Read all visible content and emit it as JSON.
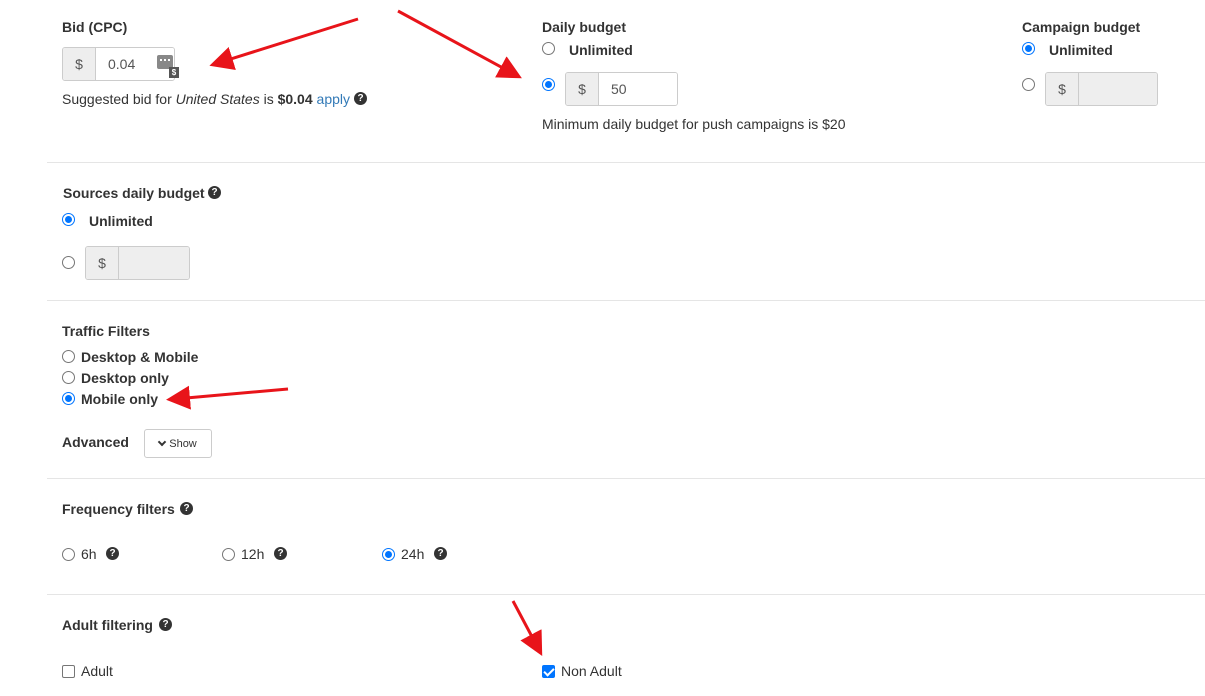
{
  "bid": {
    "title": "Bid (CPC)",
    "currency": "$",
    "value": "0.04",
    "suggest_prefix": "Suggested bid for ",
    "suggest_country": "United States",
    "suggest_mid": " is ",
    "suggest_amount": "$0.04",
    "apply_label": "apply"
  },
  "daily_budget": {
    "title": "Daily budget",
    "unlimited_label": "Unlimited",
    "currency": "$",
    "value": "50",
    "hint": "Minimum daily budget for push campaigns is $20"
  },
  "campaign_budget": {
    "title": "Campaign budget",
    "unlimited_label": "Unlimited",
    "currency": "$",
    "value": ""
  },
  "sources_budget": {
    "title": "Sources daily budget",
    "unlimited_label": "Unlimited",
    "currency": "$",
    "value": ""
  },
  "traffic_filters": {
    "title": "Traffic Filters",
    "options": [
      "Desktop & Mobile",
      "Desktop only",
      "Mobile only"
    ],
    "selected": "Mobile only",
    "advanced_label": "Advanced",
    "show_label": "Show"
  },
  "frequency": {
    "title": "Frequency filters",
    "options": [
      "6h",
      "12h",
      "24h"
    ],
    "selected": "24h"
  },
  "adult": {
    "title": "Adult filtering",
    "options": [
      "Adult",
      "Non Adult"
    ],
    "checked": "Non Adult"
  },
  "colors": {
    "accent": "#0075ff",
    "link": "#337ab7",
    "arrow": "#e8141a"
  }
}
